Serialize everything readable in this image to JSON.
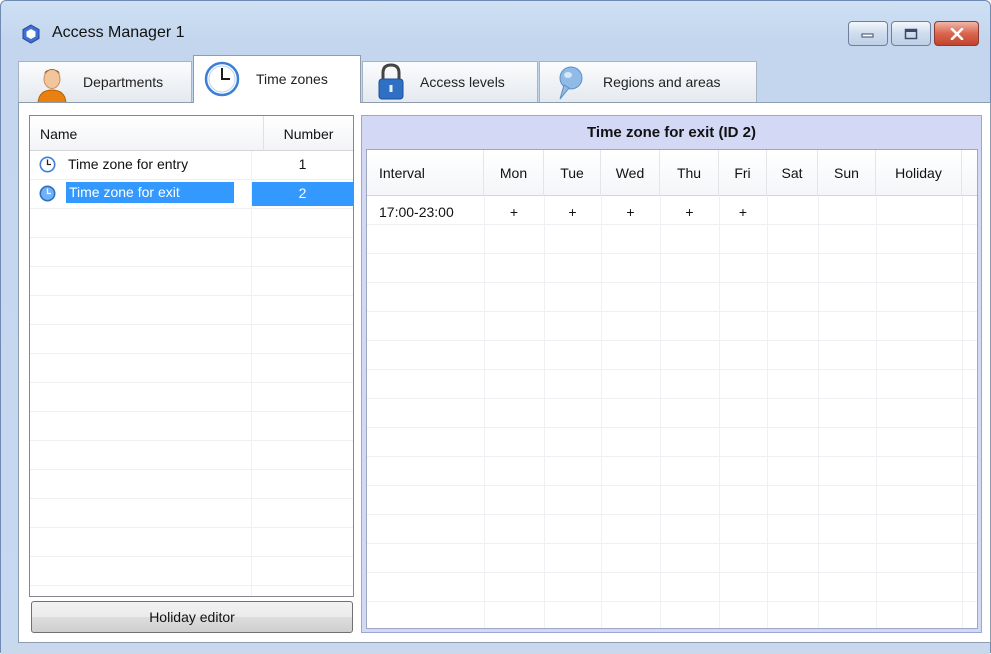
{
  "window": {
    "title": "Access Manager 1",
    "icons": {
      "app": "app-hex-icon",
      "minimize": "minimize-icon",
      "maximize": "maximize-icon",
      "close": "close-icon"
    }
  },
  "tabs": [
    {
      "label": "Departments",
      "icon": "person-icon",
      "active": false
    },
    {
      "label": "Time zones",
      "icon": "clock-icon",
      "active": true
    },
    {
      "label": "Access levels",
      "icon": "lock-icon",
      "active": false
    },
    {
      "label": "Regions and areas",
      "icon": "map-pin-icon",
      "active": false
    }
  ],
  "time_zone_list": {
    "columns": {
      "name": "Name",
      "number": "Number"
    },
    "rows": [
      {
        "name": "Time zone for entry",
        "number": "1",
        "selected": false
      },
      {
        "name": "Time zone for exit",
        "number": "2",
        "selected": true
      }
    ]
  },
  "holiday_button": {
    "label": "Holiday editor"
  },
  "schedule": {
    "title": "Time zone for exit (ID 2)",
    "columns": [
      "Interval",
      "Mon",
      "Tue",
      "Wed",
      "Thu",
      "Fri",
      "Sat",
      "Sun",
      "Holiday"
    ],
    "rows": [
      [
        "17:00-23:00",
        "+",
        "+",
        "+",
        "+",
        "+",
        "",
        "",
        ""
      ]
    ]
  },
  "colors": {
    "selection": "#3399ff",
    "window_frame": "#c7d9ef",
    "schedule_panel": "#d3d9f5",
    "close_button": "#c2432c"
  }
}
